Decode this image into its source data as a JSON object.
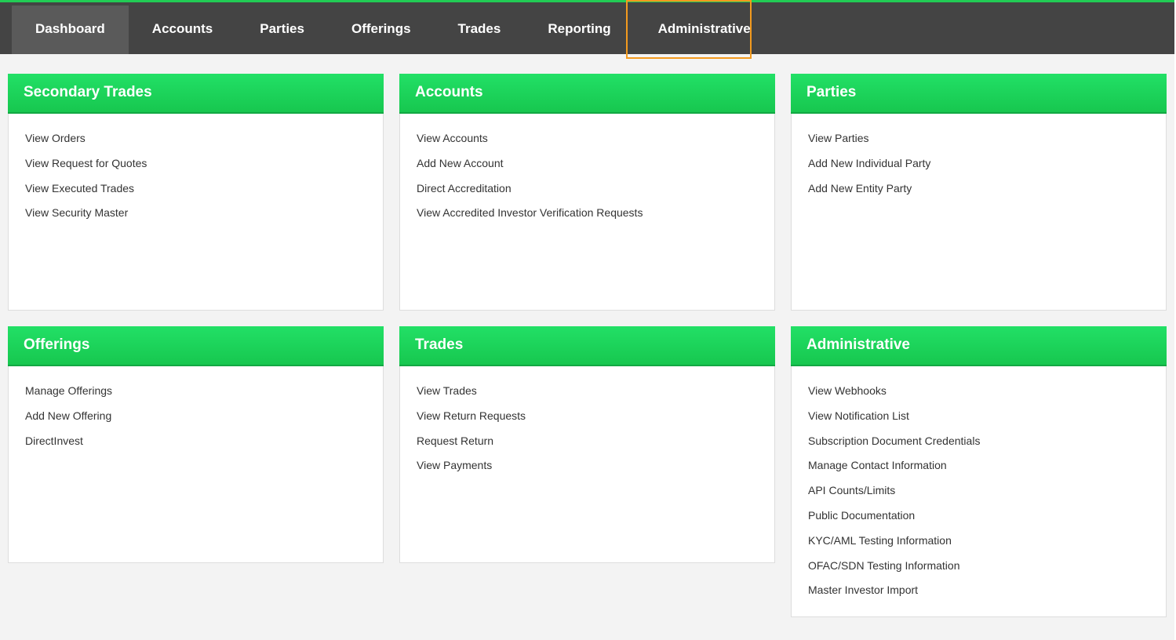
{
  "nav": {
    "items": [
      {
        "label": "Dashboard"
      },
      {
        "label": "Accounts"
      },
      {
        "label": "Parties"
      },
      {
        "label": "Offerings"
      },
      {
        "label": "Trades"
      },
      {
        "label": "Reporting"
      },
      {
        "label": "Administrative"
      }
    ]
  },
  "panels": [
    {
      "title": "Secondary Trades",
      "links": [
        "View Orders",
        "View Request for Quotes",
        "View Executed Trades",
        "View Security Master"
      ]
    },
    {
      "title": "Accounts",
      "links": [
        "View Accounts",
        "Add New Account",
        "Direct Accreditation",
        "View Accredited Investor Verification Requests"
      ]
    },
    {
      "title": "Parties",
      "links": [
        "View Parties",
        "Add New Individual Party",
        "Add New Entity Party"
      ]
    },
    {
      "title": "Offerings",
      "links": [
        "Manage Offerings",
        "Add New Offering",
        "DirectInvest"
      ]
    },
    {
      "title": "Trades",
      "links": [
        "View Trades",
        "View Return Requests",
        "Request Return",
        "View Payments"
      ]
    },
    {
      "title": "Administrative",
      "links": [
        "View Webhooks",
        "View Notification List",
        "Subscription Document Credentials",
        "Manage Contact Information",
        "API Counts/Limits",
        "Public Documentation",
        "KYC/AML Testing Information",
        "OFAC/SDN Testing Information",
        "Master Investor Import"
      ]
    }
  ],
  "colors": {
    "accent_green": "#1ed45c",
    "nav_background": "#444444",
    "highlight_orange": "#f39a1e"
  }
}
